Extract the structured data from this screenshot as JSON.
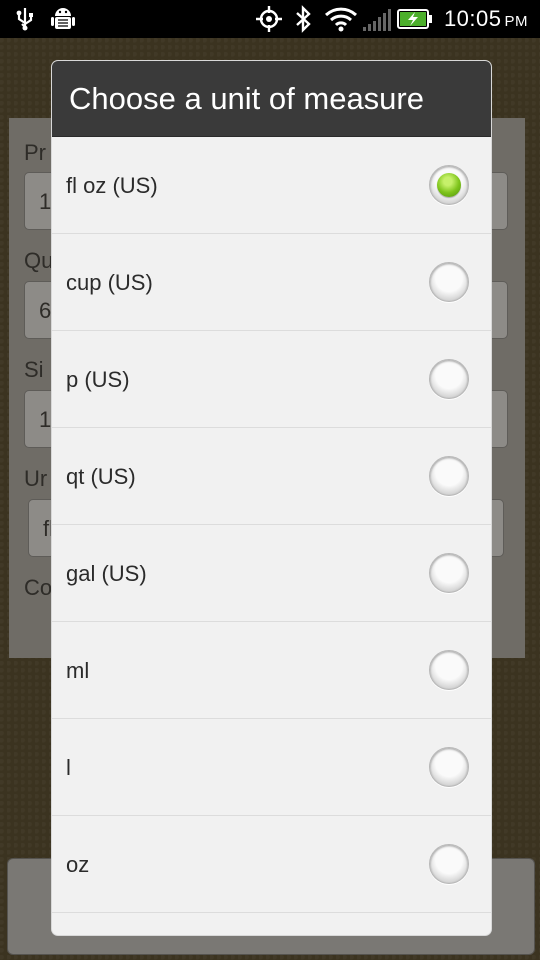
{
  "status_bar": {
    "time": "10:05",
    "ampm": "PM",
    "icons": [
      "usb-icon",
      "android-debug-icon",
      "gps-icon",
      "bluetooth-icon",
      "wifi-icon",
      "signal-icon",
      "battery-charging-icon"
    ],
    "battery_color": "#4caf2b"
  },
  "background_app": {
    "labels": [
      "Pr",
      "Qu",
      "Si",
      "Ur",
      "Co"
    ],
    "field_values": [
      "1",
      "6",
      "1",
      "fl"
    ]
  },
  "dialog": {
    "title": "Choose a unit of measure",
    "selected_index": 0,
    "accent_color": "#7ec41b",
    "options": [
      {
        "label": "fl oz (US)"
      },
      {
        "label": "cup (US)"
      },
      {
        "label": "p (US)"
      },
      {
        "label": "qt (US)"
      },
      {
        "label": "gal (US)"
      },
      {
        "label": "ml"
      },
      {
        "label": "l"
      },
      {
        "label": "oz"
      }
    ]
  }
}
